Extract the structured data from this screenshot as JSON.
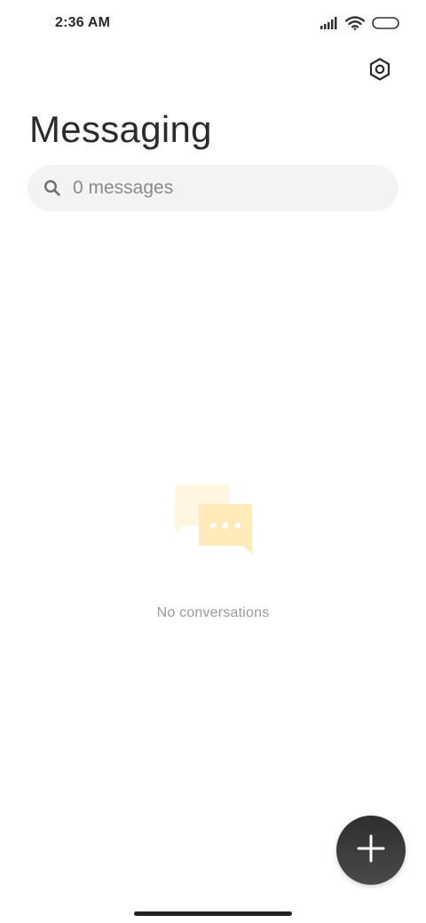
{
  "status_bar": {
    "time": "2:36 AM",
    "icons": [
      "signal-icon",
      "wifi-icon",
      "battery-icon"
    ]
  },
  "header": {
    "title": "Messaging",
    "settings_icon": "settings-icon"
  },
  "search": {
    "placeholder": "0 messages",
    "value": "",
    "icon": "search-icon"
  },
  "empty_state": {
    "icon": "chat-bubbles-icon",
    "text": "No conversations"
  },
  "fab": {
    "icon": "plus-icon"
  },
  "colors": {
    "illustration_back": "#fff4d9",
    "illustration_front": "#ffe9b8",
    "fab": "#3a3a3a",
    "search_bg": "#f3f3f3"
  }
}
